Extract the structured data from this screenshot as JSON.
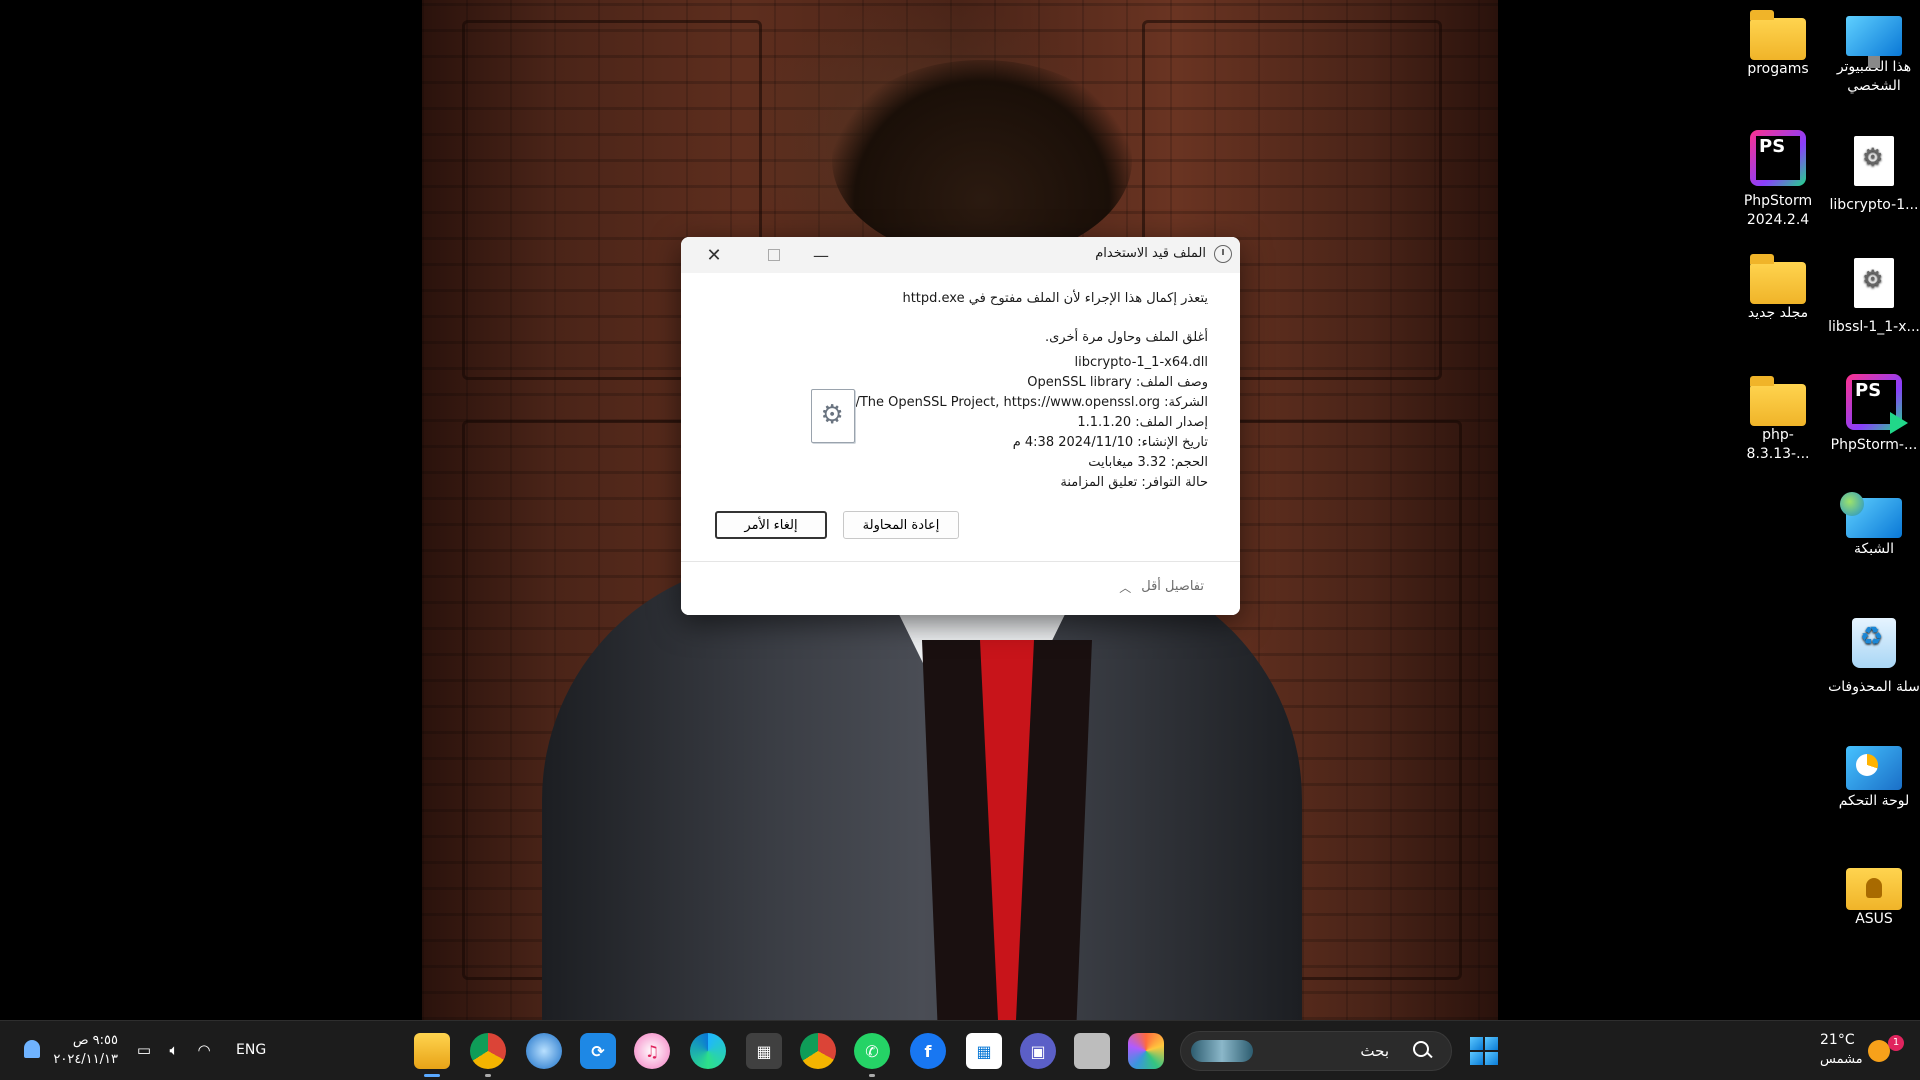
{
  "desktop": {
    "icons": [
      {
        "label": "هذا الكمبيوتر الشخصي",
        "icon": "computer-icon"
      },
      {
        "label": "progams",
        "icon": "folder-icon"
      },
      {
        "label": "libcrypto-1...",
        "icon": "dll-file-icon"
      },
      {
        "label": "PhpStorm 2024.2.4",
        "icon": "phpstorm-icon"
      },
      {
        "label": "libssl-1_1-x...",
        "icon": "dll-file-icon"
      },
      {
        "label": "مجلد جديد",
        "icon": "folder-icon"
      },
      {
        "label": "PhpStorm-...",
        "icon": "phpstorm-installer-icon"
      },
      {
        "label": "php-8.3.13-...",
        "icon": "folder-icon"
      },
      {
        "label": "الشبكة",
        "icon": "network-icon"
      },
      {
        "label": "سلة المحذوفات",
        "icon": "recycle-bin-icon"
      },
      {
        "label": "لوحة التحكم",
        "icon": "control-panel-icon"
      },
      {
        "label": "ASUS",
        "icon": "user-folder-icon"
      }
    ]
  },
  "dialog": {
    "title": "الملف قيد الاستخدام",
    "message": "يتعذر إكمال هذا الإجراء لأن الملف مفتوح في httpd.exe",
    "instruction": "أغلق الملف وحاول مرة أخرى.",
    "file": {
      "name": "libcrypto-1_1-x64.dll",
      "description": "وصف الملف: OpenSSL library",
      "company": "الشركة: The OpenSSL Project, https://www.openssl.org/",
      "version": "إصدار الملف: 1.1.1.20",
      "created": "تاريخ الإنشاء: 2024/11/10 4:38 م",
      "size": "الحجم: 3.32 ميغابايت",
      "availability": "حالة التوافر: تعليق المزامنة"
    },
    "retry_label": "إعادة المحاولة",
    "cancel_label": "إلغاء الأمر",
    "fewer_details_label": "تفاصيل أقل"
  },
  "taskbar": {
    "clock_time": "٩:٥٥ ص",
    "clock_date": "٢٠٢٤/١١/١٣",
    "language": "ENG",
    "search_label": "بحث",
    "weather_temp": "21°C",
    "weather_condition": "مشمس",
    "weather_badge": "1",
    "apps": [
      "file-explorer",
      "chrome-canary",
      "app",
      "sync",
      "itunes",
      "edge",
      "calculator",
      "chrome",
      "whatsapp",
      "facebook",
      "microsoft-store",
      "teams",
      "task-view",
      "copilot-pre"
    ]
  },
  "colors": {
    "accent": "#0a7bd6",
    "taskbar_bg": "#1c1c1c",
    "dialog_titlebar": "#f3f3f3"
  }
}
